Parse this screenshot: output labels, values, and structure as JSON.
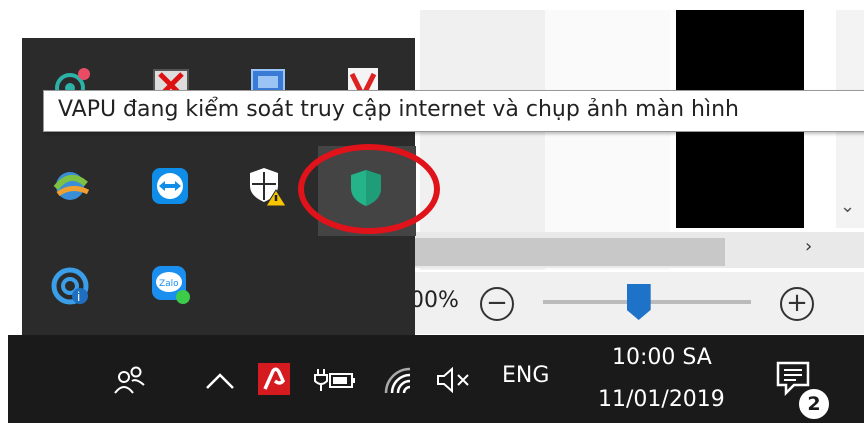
{
  "tooltip": {
    "text": "VAPU đang kiểm soát truy cập internet và chụp ảnh màn hình"
  },
  "tray_overflow": {
    "icons": [
      "sync-badge-icon",
      "red-x-app-icon",
      "network-monitor-icon",
      "red-v-app-icon",
      "internet-download-manager-icon",
      "teamviewer-icon",
      "windows-security-warning-icon",
      "vapu-shield-icon",
      "cc-cleaner-icon",
      "zalo-icon"
    ],
    "highlighted": "vapu-shield-icon"
  },
  "background_window": {
    "zoom_percent": "00%",
    "zoom_minus": "−",
    "zoom_plus": "+",
    "zoom_slider_level": 0.46
  },
  "taskbar": {
    "language": "ENG",
    "time": "10:00 SA",
    "date": "11/01/2019",
    "notification_count": "2",
    "tray_icons": [
      "people-icon",
      "chevron-up-icon",
      "avira-icon",
      "power-icon",
      "wifi-icon",
      "volume-muted-icon",
      "action-center-icon"
    ]
  },
  "colors": {
    "flyout_bg": "#2b2b2b",
    "taskbar_bg": "#1a1a1a",
    "vapu_shield": "#25b489",
    "annotation_circle": "#e0131b",
    "avira": "#d51a20",
    "zoom_thumb": "#1e72c8"
  }
}
